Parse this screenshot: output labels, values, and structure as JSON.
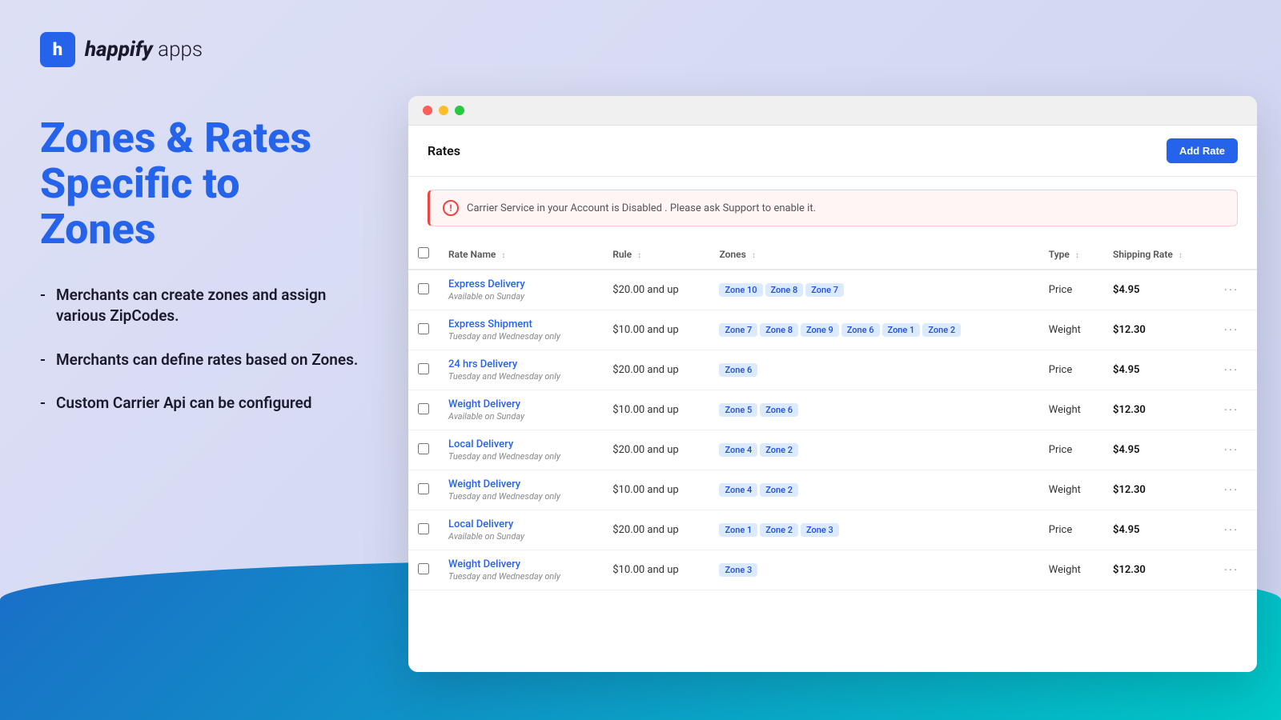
{
  "logo": {
    "icon_letter": "h",
    "brand": "happify",
    "suffix": " apps"
  },
  "headline": "Zones & Rates Specific to Zones",
  "bullets": [
    "Merchants can create zones and assign various ZipCodes.",
    "Merchants can define rates based on Zones.",
    "Custom Carrier Api can be configured"
  ],
  "browser": {
    "title": "Rates",
    "add_rate_label": "Add Rate",
    "alert_text": "Carrier Service in your Account is Disabled . Please ask Support to enable it.",
    "table": {
      "columns": [
        "Rate Name",
        "Rule",
        "Zones",
        "Type",
        "Shipping Rate"
      ],
      "rows": [
        {
          "name": "Express Delivery",
          "subtitle": "Available on Sunday",
          "rule": "$20.00 and up",
          "zones": [
            "Zone 10",
            "Zone 8",
            "Zone 7"
          ],
          "type": "Price",
          "shipping_rate": "$4.95"
        },
        {
          "name": "Express Shipment",
          "subtitle": "Tuesday and Wednesday only",
          "rule": "$10.00 and up",
          "zones": [
            "Zone 7",
            "Zone 8",
            "Zone 9",
            "Zone 6",
            "Zone 1",
            "Zone 2"
          ],
          "type": "Weight",
          "shipping_rate": "$12.30"
        },
        {
          "name": "24 hrs Delivery",
          "subtitle": "Tuesday and Wednesday only",
          "rule": "$20.00 and up",
          "zones": [
            "Zone 6"
          ],
          "type": "Price",
          "shipping_rate": "$4.95"
        },
        {
          "name": "Weight Delivery",
          "subtitle": "Available on Sunday",
          "rule": "$10.00 and up",
          "zones": [
            "Zone 5",
            "Zone 6"
          ],
          "type": "Weight",
          "shipping_rate": "$12.30"
        },
        {
          "name": "Local Delivery",
          "subtitle": "Tuesday and Wednesday only",
          "rule": "$20.00 and up",
          "zones": [
            "Zone 4",
            "Zone 2"
          ],
          "type": "Price",
          "shipping_rate": "$4.95"
        },
        {
          "name": "Weight Delivery",
          "subtitle": "Tuesday and Wednesday only",
          "rule": "$10.00 and up",
          "zones": [
            "Zone 4",
            "Zone 2"
          ],
          "type": "Weight",
          "shipping_rate": "$12.30"
        },
        {
          "name": "Local Delivery",
          "subtitle": "Available on Sunday",
          "rule": "$20.00 and up",
          "zones": [
            "Zone 1",
            "Zone 2",
            "Zone 3"
          ],
          "type": "Price",
          "shipping_rate": "$4.95"
        },
        {
          "name": "Weight Delivery",
          "subtitle": "Tuesday and Wednesday only",
          "rule": "$10.00 and up",
          "zones": [
            "Zone 3"
          ],
          "type": "Weight",
          "shipping_rate": "$12.30"
        }
      ]
    }
  }
}
